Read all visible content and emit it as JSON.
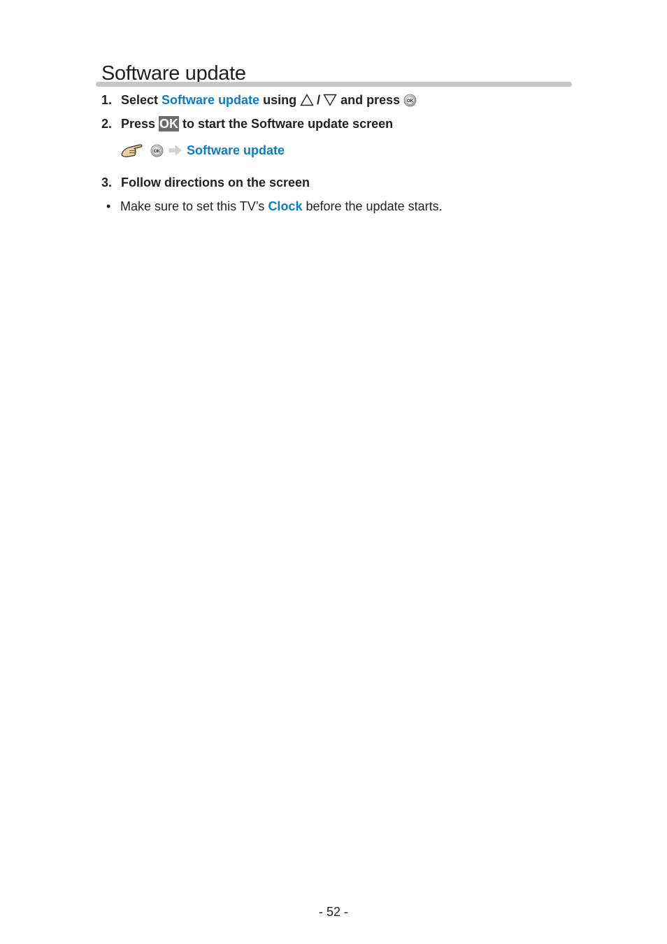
{
  "page": {
    "title": "Software update",
    "page_number": "- 52 -"
  },
  "colors": {
    "link": "#0a7dc8",
    "text": "#231f20",
    "rule": "#c6c6c6",
    "ok_key_bg": "#6b6b6b"
  },
  "steps": [
    {
      "number": "1.",
      "text_before": "Select",
      "link": "Software update",
      "text_middle": "using",
      "separator": "/",
      "text_after": "and press",
      "icons": [
        "up-triangle-icon",
        "down-triangle-icon",
        "ok-button-icon"
      ]
    },
    {
      "number": "2.",
      "text_before": "Press",
      "key": "OK",
      "text_after": "to start the Software update screen",
      "shortcut": {
        "icons": [
          "pointing-hand-icon",
          "ok-button-icon",
          "arrow-right-icon"
        ],
        "link": "Software update"
      }
    },
    {
      "number": "3.",
      "text": "Follow directions on the screen",
      "bullets": [
        {
          "marker": "•",
          "text_before": "Make sure to set this TV’s",
          "link": "Clock",
          "text_after": "before the update starts."
        }
      ]
    }
  ],
  "icons": {
    "ok_label": "OK"
  }
}
